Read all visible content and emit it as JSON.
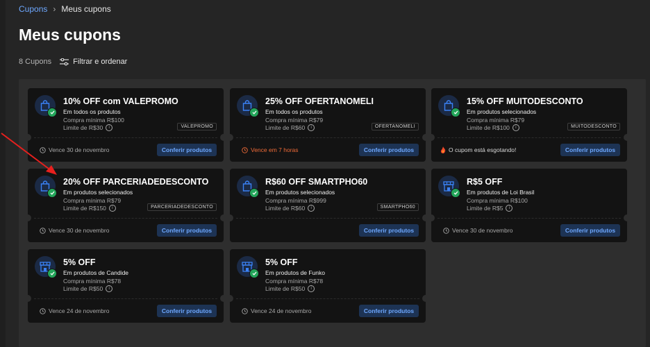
{
  "breadcrumb": {
    "parent": "Cupons",
    "current": "Meus cupons"
  },
  "title": "Meus cupons",
  "toolbar": {
    "count": "8 Cupons",
    "filter_label": "Filtrar e ordenar"
  },
  "colors": {
    "accent": "#6ea8ff",
    "button_bg": "#1d3354",
    "check": "#23a55a",
    "warn": "#f06b38"
  },
  "cards": [
    {
      "title": "10% OFF com VALEPROMO",
      "scope": "Em todos os produtos",
      "min": "Compra mínima R$100",
      "limit": "Limite de R$30",
      "code": "VALEPROMO",
      "note": "Vence 30 de novembro",
      "note_type": "clock",
      "icon": "bag-icon",
      "button": "Conferir produtos"
    },
    {
      "title": "25% OFF OFERTANOMELI",
      "scope": "Em todos os produtos",
      "min": "Compra mínima R$79",
      "limit": "Limite de R$60",
      "code": "OFERTANOMELI",
      "note": "Vence em 7 horas",
      "note_type": "warn",
      "icon": "bag-icon",
      "button": "Conferir produtos"
    },
    {
      "title": "15% OFF MUITODESCONTO",
      "scope": "Em produtos selecionados",
      "min": "Compra mínima R$79",
      "limit": "Limite de R$100",
      "code": "MUITODESCONTO",
      "note": "O cupom está esgotando!",
      "note_type": "fire",
      "icon": "bag-icon",
      "button": "Conferir produtos"
    },
    {
      "title": "20% OFF PARCERIADEDESCONTO",
      "scope": "Em produtos selecionados",
      "min": "Compra mínima R$79",
      "limit": "Limite de R$150",
      "code": "PARCERIADEDESCONTO",
      "note": "Vence 30 de novembro",
      "note_type": "clock",
      "icon": "bag-icon",
      "button": "Conferir produtos"
    },
    {
      "title": "R$60 OFF SMARTPHO60",
      "scope": "Em produtos selecionados",
      "min": "Compra mínima R$999",
      "limit": "Limite de R$60",
      "code": "SMARTPHO60",
      "note": "",
      "note_type": "none",
      "icon": "bag-icon",
      "button": "Conferir produtos"
    },
    {
      "title": "R$5 OFF",
      "scope": "Em produtos de Loi Brasil",
      "min": "Compra mínima R$100",
      "limit": "Limite de R$5",
      "code": "",
      "note": "Vence 30 de novembro",
      "note_type": "clock",
      "icon": "store-icon",
      "button": "Conferir produtos"
    },
    {
      "title": "5% OFF",
      "scope": "Em produtos de Candide",
      "min": "Compra mínima R$78",
      "limit": "Limite de R$50",
      "code": "",
      "note": "Vence 24 de novembro",
      "note_type": "clock",
      "icon": "store-icon",
      "button": "Conferir produtos"
    },
    {
      "title": "5% OFF",
      "scope": "Em produtos de Funko",
      "min": "Compra mínima R$78",
      "limit": "Limite de R$50",
      "code": "",
      "note": "Vence 24 de novembro",
      "note_type": "clock",
      "icon": "store-icon",
      "button": "Conferir produtos"
    }
  ]
}
